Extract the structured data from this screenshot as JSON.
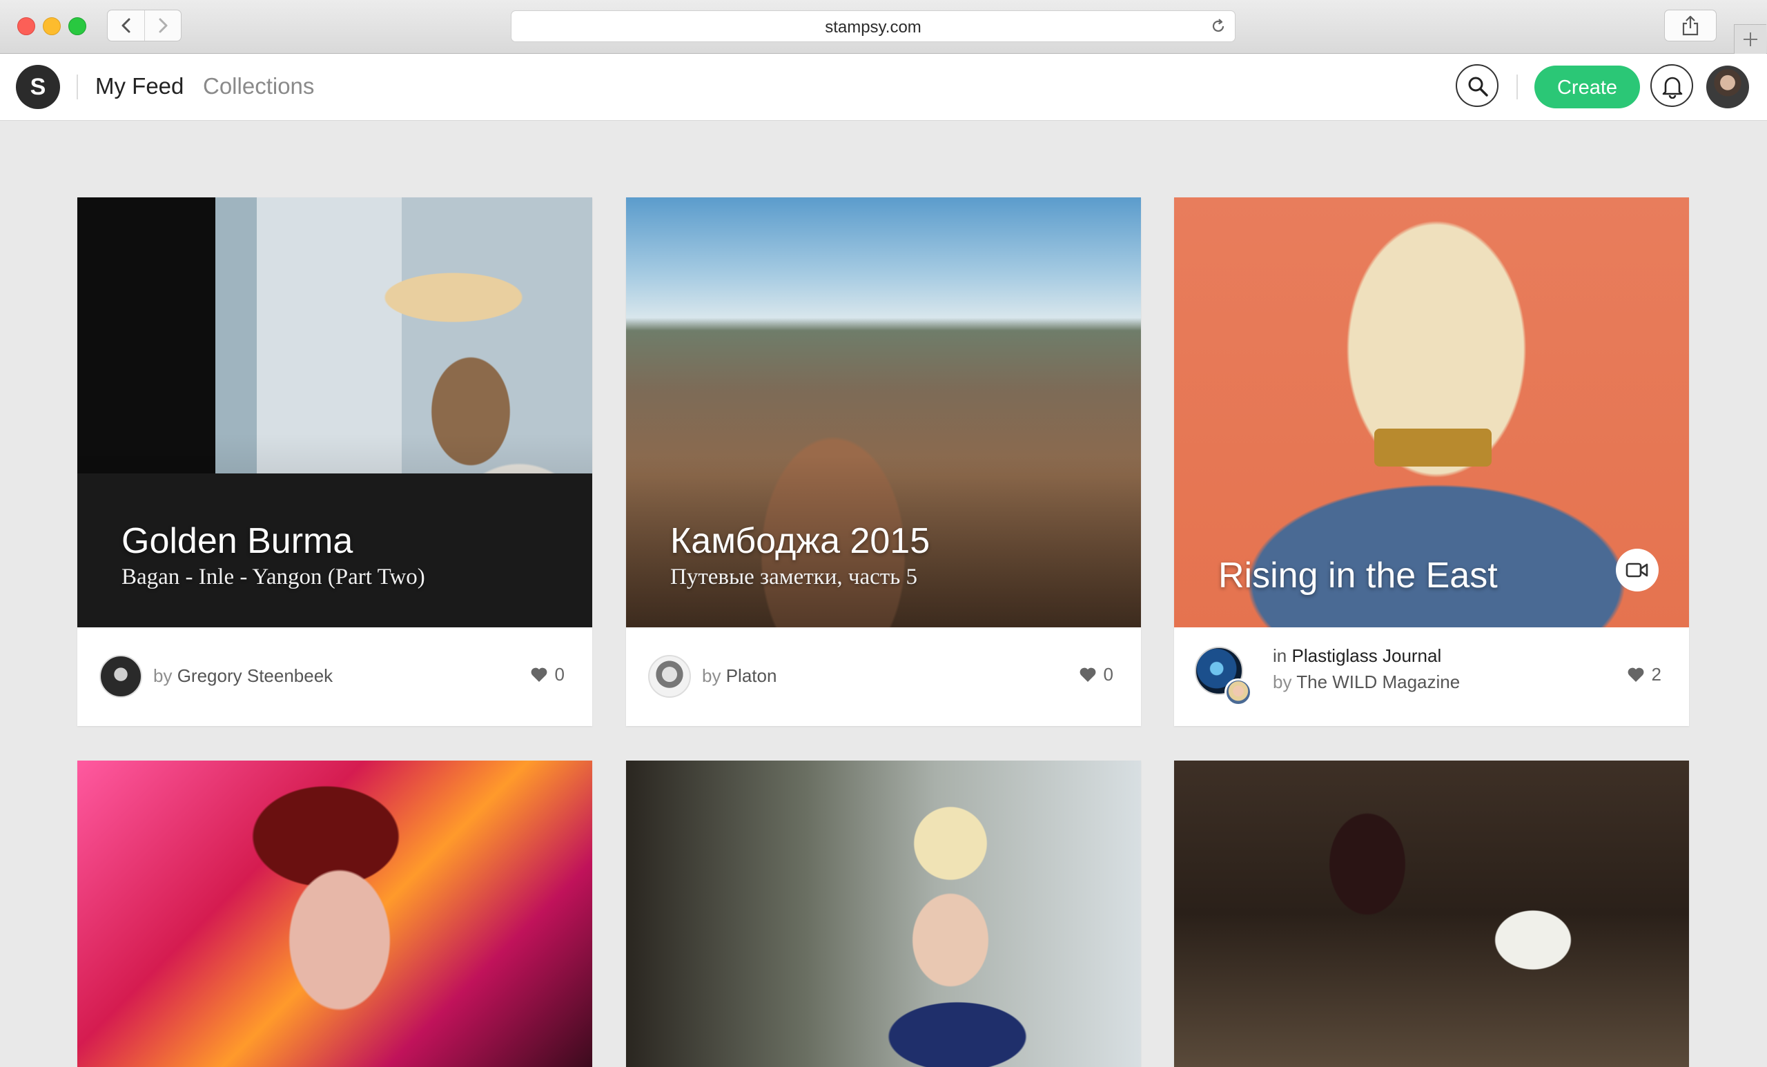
{
  "browser": {
    "url": "stampsy.com"
  },
  "header": {
    "logo_letter": "S",
    "nav": {
      "feed": "My Feed",
      "collections": "Collections"
    },
    "create_label": "Create"
  },
  "cards": [
    {
      "title": "Golden Burma",
      "subtitle": "Bagan - Inle - Yangon (Part Two)",
      "by_prefix": "by",
      "author": "Gregory Steenbeek",
      "likes": "0"
    },
    {
      "title": "Камбоджа 2015",
      "subtitle": "Путевые заметки, часть 5",
      "by_prefix": "by",
      "author": "Platon",
      "likes": "0"
    },
    {
      "title": "Rising in the East",
      "in_prefix": "in",
      "collection": "Plastiglass Journal",
      "by_prefix": "by",
      "author": "The WILD Magazine",
      "likes": "2",
      "has_video": true
    }
  ],
  "icons": {
    "back": "chevron-left-icon",
    "forward": "chevron-right-icon",
    "reload": "reload-icon",
    "share": "share-icon",
    "new_tab": "plus-icon",
    "search": "search-icon",
    "notifications": "bell-icon",
    "like": "heart-icon",
    "video": "video-camera-icon"
  },
  "colors": {
    "accent": "#2bc776",
    "page_bg": "#e9e9e9"
  }
}
